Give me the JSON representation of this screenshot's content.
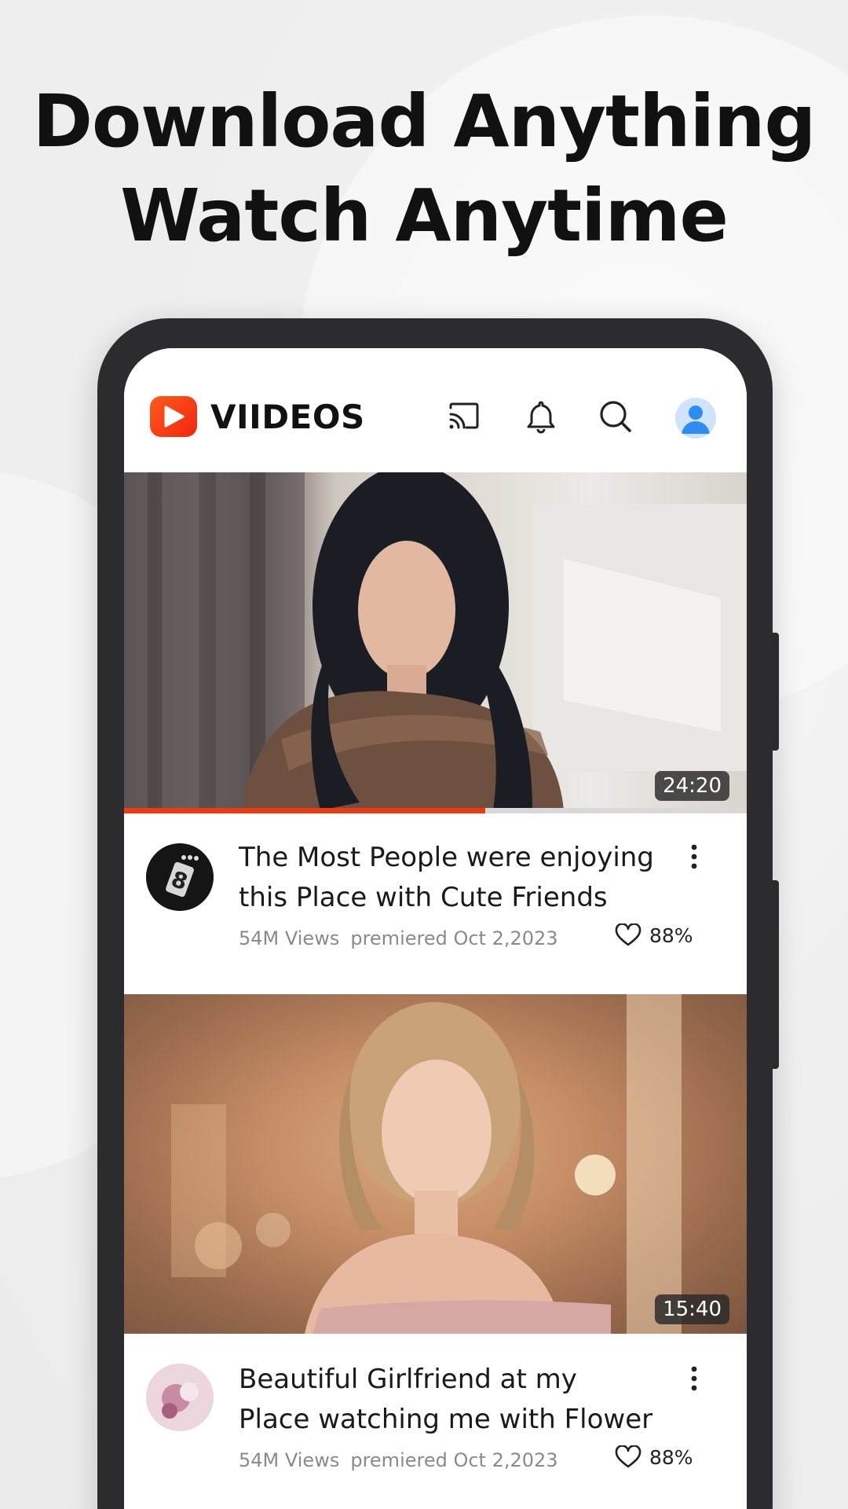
{
  "headline": {
    "line1": "Download Anything",
    "line2": "Watch Anytime"
  },
  "app": {
    "brand": "VIIDEOS",
    "header_icons": [
      "cast-icon",
      "bell-icon",
      "search-icon",
      "profile-avatar"
    ]
  },
  "videos": [
    {
      "duration": "24:20",
      "progress": 0.58,
      "title_line1": "The Most People were enjoying",
      "title_line2": "this Place with Cute Friends",
      "views": "54M Views",
      "premiered": "premiered Oct 2,2023",
      "likes": "88%"
    },
    {
      "duration": "15:40",
      "title_line1": "Beautiful Girlfriend at my",
      "title_line2": "Place watching me with Flower",
      "views": "54M Views",
      "premiered": "premiered Oct 2,2023",
      "likes": "88%"
    }
  ],
  "colors": {
    "brand_red": "#f0260e",
    "progress": "#ee3a12",
    "avatar_blue": "#2f8cf0"
  }
}
